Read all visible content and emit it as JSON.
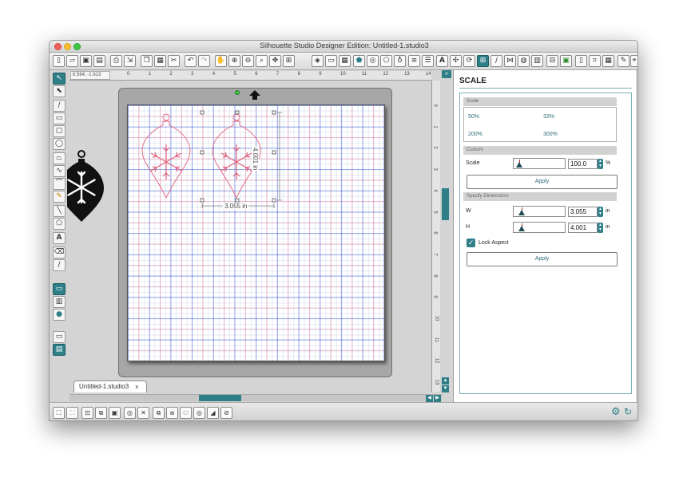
{
  "window": {
    "title": "Silhouette Studio Designer Edition: Untitled-1.studio3",
    "close_color": "#f25f58",
    "minimize_color": "#fbbe2e",
    "zoom_color": "#3ec645"
  },
  "toolbar": {
    "left_icons": [
      "new-document-icon",
      "open-folder-icon",
      "save-icon",
      "save-to-library-icon",
      "print-icon",
      "send-to-cutter-icon",
      "copy-icon",
      "paste-icon",
      "cut-icon",
      "undo-icon",
      "redo-icon",
      "pan-icon",
      "zoom-in-icon",
      "zoom-out-icon",
      "zoom-select-icon",
      "drag-zoom-icon",
      "fit-to-page-icon"
    ],
    "right_icons": [
      "fill-color-icon",
      "line-color-icon",
      "gradient-icon",
      "fill-pattern-icon",
      "line-style-icon",
      "shadow-icon",
      "line-width-icon",
      "trace-icon",
      "align-icon",
      "text-icon",
      "transform-icon",
      "rotate-icon",
      "scale-icon",
      "knife-icon",
      "mirror-icon",
      "offset-icon",
      "replicate-icon",
      "modify-icon",
      "layers-icon",
      "page-setup-icon",
      "registration-icon",
      "cut-settings-icon",
      "send-icon",
      "library-icon",
      "store-icon"
    ]
  },
  "ruler": {
    "coords": "6.564, -1.613",
    "h_ticks": [
      "0",
      "1",
      "2",
      "3",
      "4",
      "5",
      "6",
      "7",
      "8",
      "9",
      "10",
      "11",
      "12",
      "13",
      "14"
    ],
    "v_ticks": [
      "0",
      "1",
      "2",
      "3",
      "4",
      "5",
      "6",
      "7",
      "8",
      "9",
      "10",
      "11",
      "12",
      "13"
    ]
  },
  "canvas": {
    "width_label": "3.055 in",
    "height_label": "4.001 in"
  },
  "doc_tab": {
    "label": "Untitled-1.studio3",
    "close": "x"
  },
  "left_tools": [
    "select-tool-icon",
    "point-edit-icon",
    "line-tool-icon",
    "rectangle-tool-icon",
    "rounded-rect-tool-icon",
    "ellipse-tool-icon",
    "polygon-tool-icon",
    "curve-tool-icon",
    "arc-tool-icon",
    "freehand-tool-icon",
    "smooth-freehand-icon",
    "regular-polygon-icon",
    "text-tool-icon",
    "eraser-tool-icon",
    "knife-tool-icon",
    "design-page-icon",
    "library-icon",
    "online-store-icon",
    "single-view-icon",
    "split-view-icon"
  ],
  "bottom_icons": [
    "select-all-icon",
    "deselect-icon",
    "group-icon",
    "ungroup-icon",
    "compound-path-icon",
    "release-compound-icon",
    "bring-to-front-icon",
    "send-to-back-icon",
    "weld-icon",
    "offset-icon",
    "trace-icon",
    "modify-icon"
  ],
  "panel": {
    "title": "SCALE",
    "scale_group": {
      "header": "Scale",
      "options": [
        "50%",
        "33%",
        "200%",
        "300%"
      ]
    },
    "custom_group": {
      "header": "Custom",
      "label": "Scale",
      "value": "100.0",
      "unit": "%",
      "slider_fraction": 0.1,
      "apply": "Apply"
    },
    "dimensions_group": {
      "header": "Specify Dimensions",
      "w_label": "W",
      "w_value": "3.055",
      "h_label": "H",
      "h_value": "4.001",
      "unit": "in",
      "lock_label": "Lock Aspect",
      "lock_checked": true,
      "apply": "Apply"
    }
  },
  "colors": {
    "accent": "#2f7f88",
    "cut_line": "#e0607a",
    "grid_blue": "#4664dc"
  }
}
